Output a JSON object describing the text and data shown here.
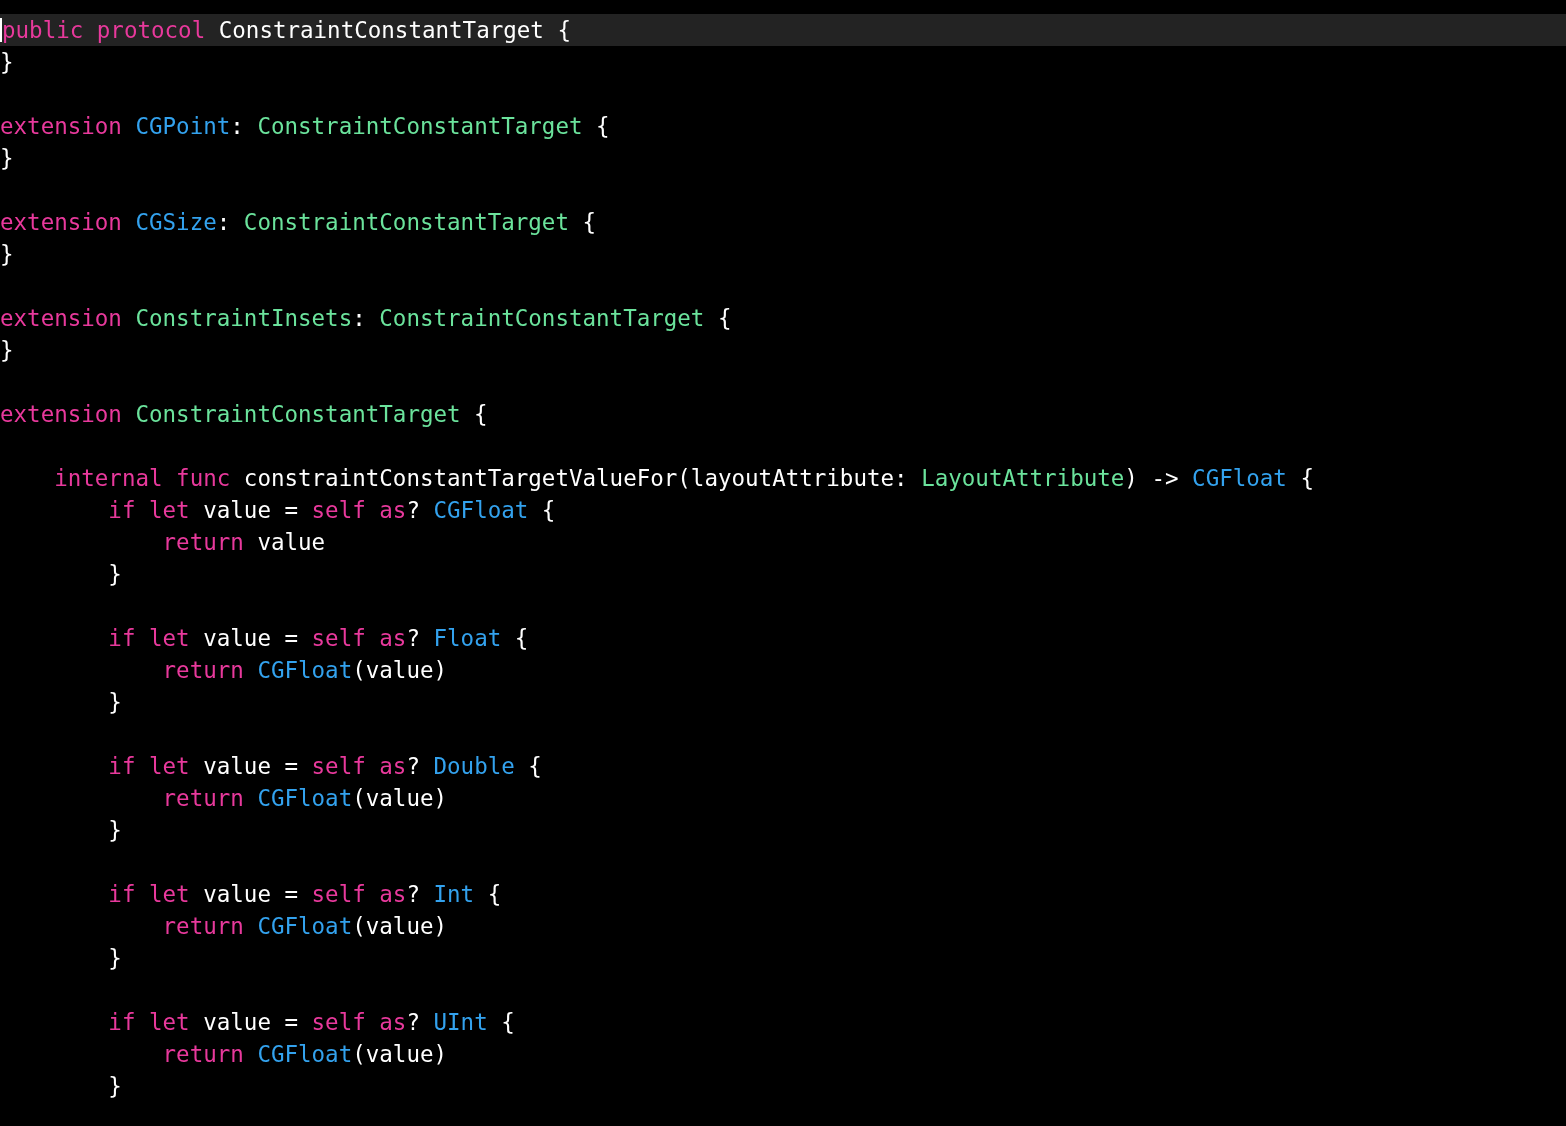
{
  "editor": {
    "lines": [
      {
        "kind": "code",
        "current": true,
        "tokens": [
          {
            "kind": "kw",
            "text": "public"
          },
          {
            "kind": "kw",
            "text": " protocol"
          },
          {
            "kind": "plain",
            "text": " ConstraintConstantTarget {"
          }
        ]
      },
      {
        "kind": "code",
        "current": false,
        "tokens": [
          {
            "kind": "plain",
            "text": "}"
          }
        ]
      },
      {
        "kind": "blank"
      },
      {
        "kind": "code",
        "current": false,
        "tokens": [
          {
            "kind": "kw",
            "text": "extension"
          },
          {
            "kind": "type",
            "text": " CGPoint"
          },
          {
            "kind": "plain",
            "text": ": "
          },
          {
            "kind": "own",
            "text": "ConstraintConstantTarget"
          },
          {
            "kind": "plain",
            "text": " {"
          }
        ]
      },
      {
        "kind": "code",
        "current": false,
        "tokens": [
          {
            "kind": "plain",
            "text": "}"
          }
        ]
      },
      {
        "kind": "blank"
      },
      {
        "kind": "code",
        "current": false,
        "tokens": [
          {
            "kind": "kw",
            "text": "extension"
          },
          {
            "kind": "type",
            "text": " CGSize"
          },
          {
            "kind": "plain",
            "text": ": "
          },
          {
            "kind": "own",
            "text": "ConstraintConstantTarget"
          },
          {
            "kind": "plain",
            "text": " {"
          }
        ]
      },
      {
        "kind": "code",
        "current": false,
        "tokens": [
          {
            "kind": "plain",
            "text": "}"
          }
        ]
      },
      {
        "kind": "blank"
      },
      {
        "kind": "code",
        "current": false,
        "tokens": [
          {
            "kind": "kw",
            "text": "extension"
          },
          {
            "kind": "own",
            "text": " ConstraintInsets"
          },
          {
            "kind": "plain",
            "text": ": "
          },
          {
            "kind": "own",
            "text": "ConstraintConstantTarget"
          },
          {
            "kind": "plain",
            "text": " {"
          }
        ]
      },
      {
        "kind": "code",
        "current": false,
        "tokens": [
          {
            "kind": "plain",
            "text": "}"
          }
        ]
      },
      {
        "kind": "blank"
      },
      {
        "kind": "code",
        "current": false,
        "tokens": [
          {
            "kind": "kw",
            "text": "extension"
          },
          {
            "kind": "own",
            "text": " ConstraintConstantTarget"
          },
          {
            "kind": "plain",
            "text": " {"
          }
        ]
      },
      {
        "kind": "blank"
      },
      {
        "kind": "code",
        "current": false,
        "tokens": [
          {
            "kind": "kw",
            "text": "    internal"
          },
          {
            "kind": "kw",
            "text": " func"
          },
          {
            "kind": "plain",
            "text": " constraintConstantTargetValueFor(layoutAttribute: "
          },
          {
            "kind": "own",
            "text": "LayoutAttribute"
          },
          {
            "kind": "plain",
            "text": ") -> "
          },
          {
            "kind": "type",
            "text": "CGFloat"
          },
          {
            "kind": "plain",
            "text": " {"
          }
        ]
      },
      {
        "kind": "code",
        "current": false,
        "tokens": [
          {
            "kind": "kw",
            "text": "        if"
          },
          {
            "kind": "kw",
            "text": " let"
          },
          {
            "kind": "plain",
            "text": " value = "
          },
          {
            "kind": "kw",
            "text": "self"
          },
          {
            "kind": "kw",
            "text": " as"
          },
          {
            "kind": "plain",
            "text": "? "
          },
          {
            "kind": "type",
            "text": "CGFloat"
          },
          {
            "kind": "plain",
            "text": " {"
          }
        ]
      },
      {
        "kind": "code",
        "current": false,
        "tokens": [
          {
            "kind": "kw",
            "text": "            return"
          },
          {
            "kind": "plain",
            "text": " value"
          }
        ]
      },
      {
        "kind": "code",
        "current": false,
        "tokens": [
          {
            "kind": "plain",
            "text": "        }"
          }
        ]
      },
      {
        "kind": "blank"
      },
      {
        "kind": "code",
        "current": false,
        "tokens": [
          {
            "kind": "kw",
            "text": "        if"
          },
          {
            "kind": "kw",
            "text": " let"
          },
          {
            "kind": "plain",
            "text": " value = "
          },
          {
            "kind": "kw",
            "text": "self"
          },
          {
            "kind": "kw",
            "text": " as"
          },
          {
            "kind": "plain",
            "text": "? "
          },
          {
            "kind": "type",
            "text": "Float"
          },
          {
            "kind": "plain",
            "text": " {"
          }
        ]
      },
      {
        "kind": "code",
        "current": false,
        "tokens": [
          {
            "kind": "kw",
            "text": "            return"
          },
          {
            "kind": "type",
            "text": " CGFloat"
          },
          {
            "kind": "plain",
            "text": "(value)"
          }
        ]
      },
      {
        "kind": "code",
        "current": false,
        "tokens": [
          {
            "kind": "plain",
            "text": "        }"
          }
        ]
      },
      {
        "kind": "blank"
      },
      {
        "kind": "code",
        "current": false,
        "tokens": [
          {
            "kind": "kw",
            "text": "        if"
          },
          {
            "kind": "kw",
            "text": " let"
          },
          {
            "kind": "plain",
            "text": " value = "
          },
          {
            "kind": "kw",
            "text": "self"
          },
          {
            "kind": "kw",
            "text": " as"
          },
          {
            "kind": "plain",
            "text": "? "
          },
          {
            "kind": "type",
            "text": "Double"
          },
          {
            "kind": "plain",
            "text": " {"
          }
        ]
      },
      {
        "kind": "code",
        "current": false,
        "tokens": [
          {
            "kind": "kw",
            "text": "            return"
          },
          {
            "kind": "type",
            "text": " CGFloat"
          },
          {
            "kind": "plain",
            "text": "(value)"
          }
        ]
      },
      {
        "kind": "code",
        "current": false,
        "tokens": [
          {
            "kind": "plain",
            "text": "        }"
          }
        ]
      },
      {
        "kind": "blank"
      },
      {
        "kind": "code",
        "current": false,
        "tokens": [
          {
            "kind": "kw",
            "text": "        if"
          },
          {
            "kind": "kw",
            "text": " let"
          },
          {
            "kind": "plain",
            "text": " value = "
          },
          {
            "kind": "kw",
            "text": "self"
          },
          {
            "kind": "kw",
            "text": " as"
          },
          {
            "kind": "plain",
            "text": "? "
          },
          {
            "kind": "type",
            "text": "Int"
          },
          {
            "kind": "plain",
            "text": " {"
          }
        ]
      },
      {
        "kind": "code",
        "current": false,
        "tokens": [
          {
            "kind": "kw",
            "text": "            return"
          },
          {
            "kind": "type",
            "text": " CGFloat"
          },
          {
            "kind": "plain",
            "text": "(value)"
          }
        ]
      },
      {
        "kind": "code",
        "current": false,
        "tokens": [
          {
            "kind": "plain",
            "text": "        }"
          }
        ]
      },
      {
        "kind": "blank"
      },
      {
        "kind": "code",
        "current": false,
        "tokens": [
          {
            "kind": "kw",
            "text": "        if"
          },
          {
            "kind": "kw",
            "text": " let"
          },
          {
            "kind": "plain",
            "text": " value = "
          },
          {
            "kind": "kw",
            "text": "self"
          },
          {
            "kind": "kw",
            "text": " as"
          },
          {
            "kind": "plain",
            "text": "? "
          },
          {
            "kind": "type",
            "text": "UInt"
          },
          {
            "kind": "plain",
            "text": " {"
          }
        ]
      },
      {
        "kind": "code",
        "current": false,
        "tokens": [
          {
            "kind": "kw",
            "text": "            return"
          },
          {
            "kind": "type",
            "text": " CGFloat"
          },
          {
            "kind": "plain",
            "text": "(value)"
          }
        ]
      },
      {
        "kind": "code",
        "current": false,
        "tokens": [
          {
            "kind": "plain",
            "text": "        }"
          }
        ]
      }
    ]
  }
}
